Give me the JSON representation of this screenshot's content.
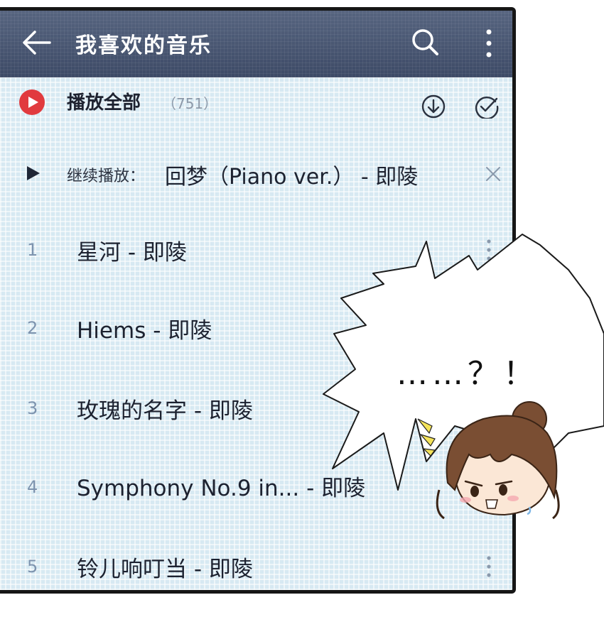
{
  "header": {
    "title": "我喜欢的音乐",
    "back_icon": "arrow-left-icon",
    "search_icon": "search-icon",
    "more_icon": "more-vertical-icon"
  },
  "play_all": {
    "label": "播放全部",
    "count": "（751）",
    "accent_color": "#e13a3e"
  },
  "resume": {
    "label": "继续播放：",
    "song": "回梦（Piano ver.） - 即陵"
  },
  "songs": [
    {
      "num": "1",
      "title": "星河 - 即陵"
    },
    {
      "num": "2",
      "title": "Hiems - 即陵"
    },
    {
      "num": "3",
      "title": "玫瑰的名字 - 即陵"
    },
    {
      "num": "4",
      "title": "Symphony No.9 in... - 即陵"
    },
    {
      "num": "5",
      "title": "铃儿响叮当 - 即陵"
    }
  ],
  "speech_bubble": {
    "text": "……？！"
  }
}
